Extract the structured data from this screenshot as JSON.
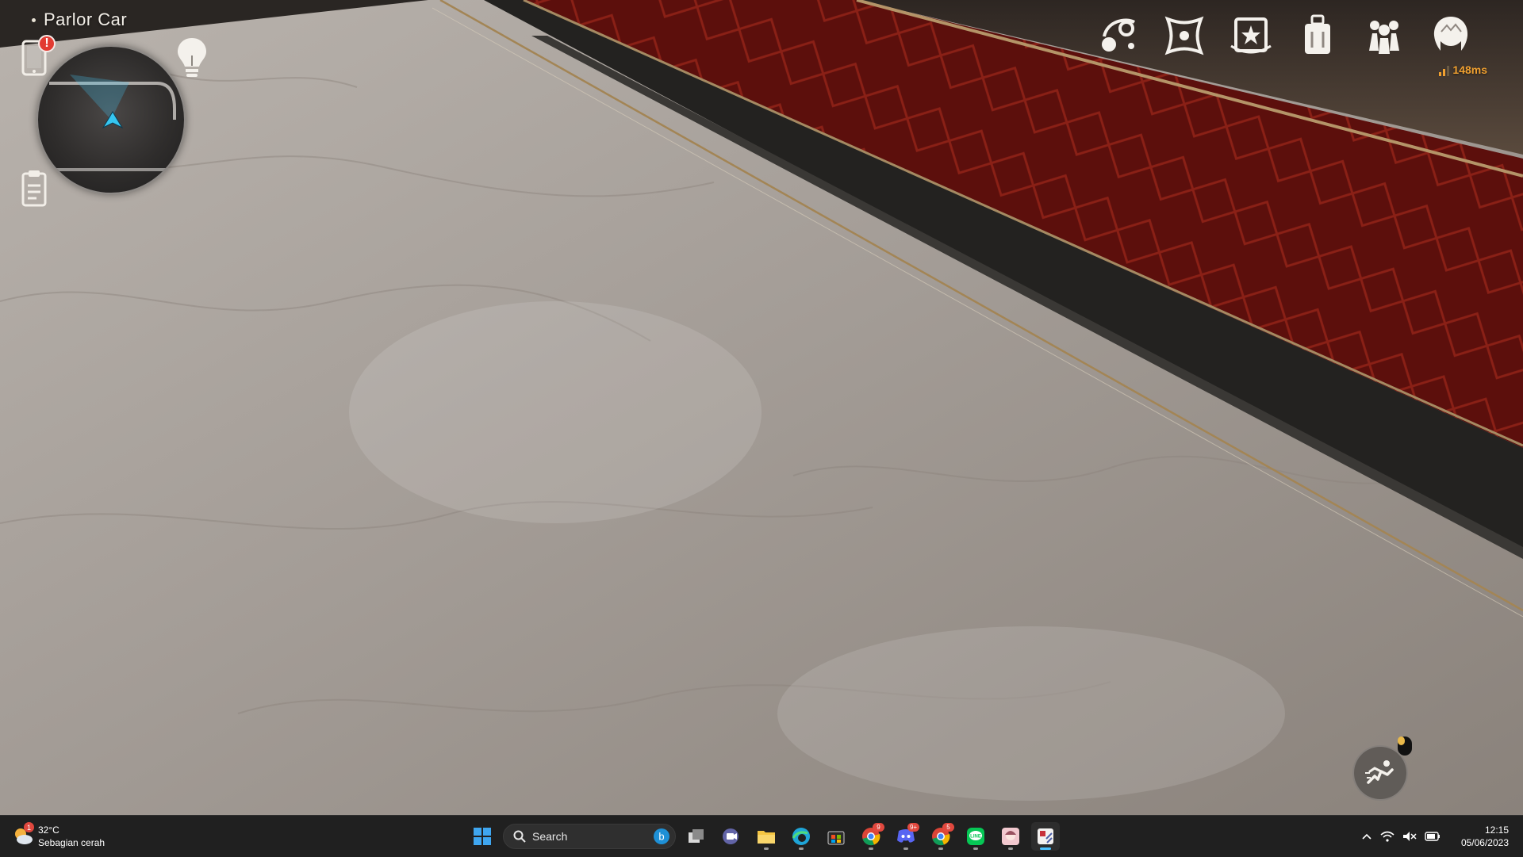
{
  "hud": {
    "location": "Parlor Car",
    "alert_mark": "!",
    "ping": "148ms",
    "menu_icons": [
      "interastral-guide-icon",
      "warp-icon",
      "star-rail-pass-icon",
      "inventory-icon",
      "character-icon",
      "trailblazer-avatar-icon"
    ],
    "colors": {
      "accent_cyan": "#36c6f0",
      "ping": "#f0a030",
      "alert": "#e23b32"
    }
  },
  "taskbar": {
    "weather": {
      "temperature": "32°C",
      "condition": "Sebagian cerah",
      "badge": "1"
    },
    "search_placeholder": "Search",
    "apps": [
      {
        "name": "task-view",
        "badge": ""
      },
      {
        "name": "teams-meet",
        "badge": ""
      },
      {
        "name": "file-explorer",
        "badge": ""
      },
      {
        "name": "edge",
        "badge": ""
      },
      {
        "name": "microsoft-store",
        "badge": ""
      },
      {
        "name": "chrome",
        "badge": "9"
      },
      {
        "name": "discord",
        "badge": "9+"
      },
      {
        "name": "chrome-profile",
        "badge": "5"
      },
      {
        "name": "line",
        "badge": ""
      },
      {
        "name": "anime-app",
        "badge": ""
      },
      {
        "name": "game",
        "badge": ""
      }
    ],
    "clock": {
      "time": "12:15",
      "date": "05/06/2023"
    }
  }
}
